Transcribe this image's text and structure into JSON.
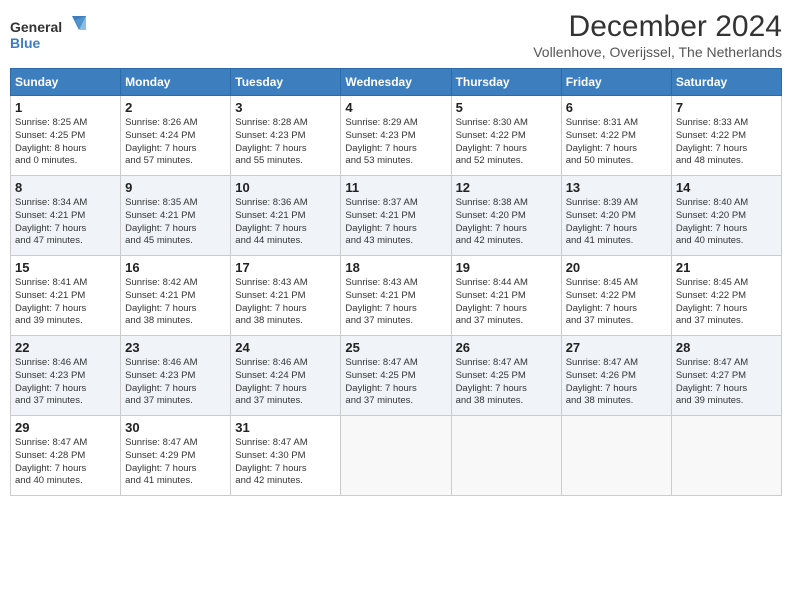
{
  "logo": {
    "line1": "General",
    "line2": "Blue"
  },
  "title": "December 2024",
  "subtitle": "Vollenhove, Overijssel, The Netherlands",
  "days_header": [
    "Sunday",
    "Monday",
    "Tuesday",
    "Wednesday",
    "Thursday",
    "Friday",
    "Saturday"
  ],
  "weeks": [
    [
      {
        "day": 1,
        "lines": [
          "Sunrise: 8:25 AM",
          "Sunset: 4:25 PM",
          "Daylight: 8 hours",
          "and 0 minutes."
        ]
      },
      {
        "day": 2,
        "lines": [
          "Sunrise: 8:26 AM",
          "Sunset: 4:24 PM",
          "Daylight: 7 hours",
          "and 57 minutes."
        ]
      },
      {
        "day": 3,
        "lines": [
          "Sunrise: 8:28 AM",
          "Sunset: 4:23 PM",
          "Daylight: 7 hours",
          "and 55 minutes."
        ]
      },
      {
        "day": 4,
        "lines": [
          "Sunrise: 8:29 AM",
          "Sunset: 4:23 PM",
          "Daylight: 7 hours",
          "and 53 minutes."
        ]
      },
      {
        "day": 5,
        "lines": [
          "Sunrise: 8:30 AM",
          "Sunset: 4:22 PM",
          "Daylight: 7 hours",
          "and 52 minutes."
        ]
      },
      {
        "day": 6,
        "lines": [
          "Sunrise: 8:31 AM",
          "Sunset: 4:22 PM",
          "Daylight: 7 hours",
          "and 50 minutes."
        ]
      },
      {
        "day": 7,
        "lines": [
          "Sunrise: 8:33 AM",
          "Sunset: 4:22 PM",
          "Daylight: 7 hours",
          "and 48 minutes."
        ]
      }
    ],
    [
      {
        "day": 8,
        "lines": [
          "Sunrise: 8:34 AM",
          "Sunset: 4:21 PM",
          "Daylight: 7 hours",
          "and 47 minutes."
        ]
      },
      {
        "day": 9,
        "lines": [
          "Sunrise: 8:35 AM",
          "Sunset: 4:21 PM",
          "Daylight: 7 hours",
          "and 45 minutes."
        ]
      },
      {
        "day": 10,
        "lines": [
          "Sunrise: 8:36 AM",
          "Sunset: 4:21 PM",
          "Daylight: 7 hours",
          "and 44 minutes."
        ]
      },
      {
        "day": 11,
        "lines": [
          "Sunrise: 8:37 AM",
          "Sunset: 4:21 PM",
          "Daylight: 7 hours",
          "and 43 minutes."
        ]
      },
      {
        "day": 12,
        "lines": [
          "Sunrise: 8:38 AM",
          "Sunset: 4:20 PM",
          "Daylight: 7 hours",
          "and 42 minutes."
        ]
      },
      {
        "day": 13,
        "lines": [
          "Sunrise: 8:39 AM",
          "Sunset: 4:20 PM",
          "Daylight: 7 hours",
          "and 41 minutes."
        ]
      },
      {
        "day": 14,
        "lines": [
          "Sunrise: 8:40 AM",
          "Sunset: 4:20 PM",
          "Daylight: 7 hours",
          "and 40 minutes."
        ]
      }
    ],
    [
      {
        "day": 15,
        "lines": [
          "Sunrise: 8:41 AM",
          "Sunset: 4:21 PM",
          "Daylight: 7 hours",
          "and 39 minutes."
        ]
      },
      {
        "day": 16,
        "lines": [
          "Sunrise: 8:42 AM",
          "Sunset: 4:21 PM",
          "Daylight: 7 hours",
          "and 38 minutes."
        ]
      },
      {
        "day": 17,
        "lines": [
          "Sunrise: 8:43 AM",
          "Sunset: 4:21 PM",
          "Daylight: 7 hours",
          "and 38 minutes."
        ]
      },
      {
        "day": 18,
        "lines": [
          "Sunrise: 8:43 AM",
          "Sunset: 4:21 PM",
          "Daylight: 7 hours",
          "and 37 minutes."
        ]
      },
      {
        "day": 19,
        "lines": [
          "Sunrise: 8:44 AM",
          "Sunset: 4:21 PM",
          "Daylight: 7 hours",
          "and 37 minutes."
        ]
      },
      {
        "day": 20,
        "lines": [
          "Sunrise: 8:45 AM",
          "Sunset: 4:22 PM",
          "Daylight: 7 hours",
          "and 37 minutes."
        ]
      },
      {
        "day": 21,
        "lines": [
          "Sunrise: 8:45 AM",
          "Sunset: 4:22 PM",
          "Daylight: 7 hours",
          "and 37 minutes."
        ]
      }
    ],
    [
      {
        "day": 22,
        "lines": [
          "Sunrise: 8:46 AM",
          "Sunset: 4:23 PM",
          "Daylight: 7 hours",
          "and 37 minutes."
        ]
      },
      {
        "day": 23,
        "lines": [
          "Sunrise: 8:46 AM",
          "Sunset: 4:23 PM",
          "Daylight: 7 hours",
          "and 37 minutes."
        ]
      },
      {
        "day": 24,
        "lines": [
          "Sunrise: 8:46 AM",
          "Sunset: 4:24 PM",
          "Daylight: 7 hours",
          "and 37 minutes."
        ]
      },
      {
        "day": 25,
        "lines": [
          "Sunrise: 8:47 AM",
          "Sunset: 4:25 PM",
          "Daylight: 7 hours",
          "and 37 minutes."
        ]
      },
      {
        "day": 26,
        "lines": [
          "Sunrise: 8:47 AM",
          "Sunset: 4:25 PM",
          "Daylight: 7 hours",
          "and 38 minutes."
        ]
      },
      {
        "day": 27,
        "lines": [
          "Sunrise: 8:47 AM",
          "Sunset: 4:26 PM",
          "Daylight: 7 hours",
          "and 38 minutes."
        ]
      },
      {
        "day": 28,
        "lines": [
          "Sunrise: 8:47 AM",
          "Sunset: 4:27 PM",
          "Daylight: 7 hours",
          "and 39 minutes."
        ]
      }
    ],
    [
      {
        "day": 29,
        "lines": [
          "Sunrise: 8:47 AM",
          "Sunset: 4:28 PM",
          "Daylight: 7 hours",
          "and 40 minutes."
        ]
      },
      {
        "day": 30,
        "lines": [
          "Sunrise: 8:47 AM",
          "Sunset: 4:29 PM",
          "Daylight: 7 hours",
          "and 41 minutes."
        ]
      },
      {
        "day": 31,
        "lines": [
          "Sunrise: 8:47 AM",
          "Sunset: 4:30 PM",
          "Daylight: 7 hours",
          "and 42 minutes."
        ]
      },
      null,
      null,
      null,
      null
    ]
  ]
}
